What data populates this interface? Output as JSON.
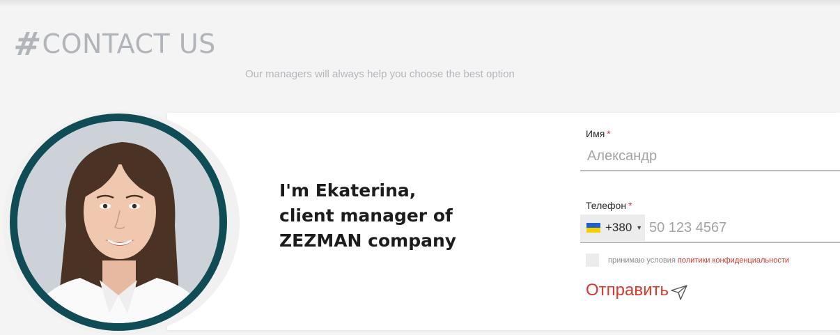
{
  "header": {
    "hash": "#",
    "title": "CONTACT US",
    "subtitle": "Our managers will always help you choose the best option"
  },
  "intro": {
    "line1": "I'm Ekaterina,",
    "line2": "client manager of",
    "line3": "ZEZMAN company"
  },
  "form": {
    "name_label": "Имя",
    "name_placeholder": "Александр",
    "required_mark": "*",
    "phone_label": "Телефон",
    "dial_code": "+380",
    "phone_placeholder": "50 123 4567",
    "consent_text": "принимаю условия",
    "consent_link": "политики конфиденциальности",
    "submit_label": "Отправить"
  },
  "icons": {
    "flag": "ukraine-flag-icon",
    "caret": "caret-down-icon",
    "send": "paper-plane-icon"
  },
  "colors": {
    "accent": "#d8382a",
    "ring": "#0f4c55",
    "title": "#b1b4b9"
  }
}
